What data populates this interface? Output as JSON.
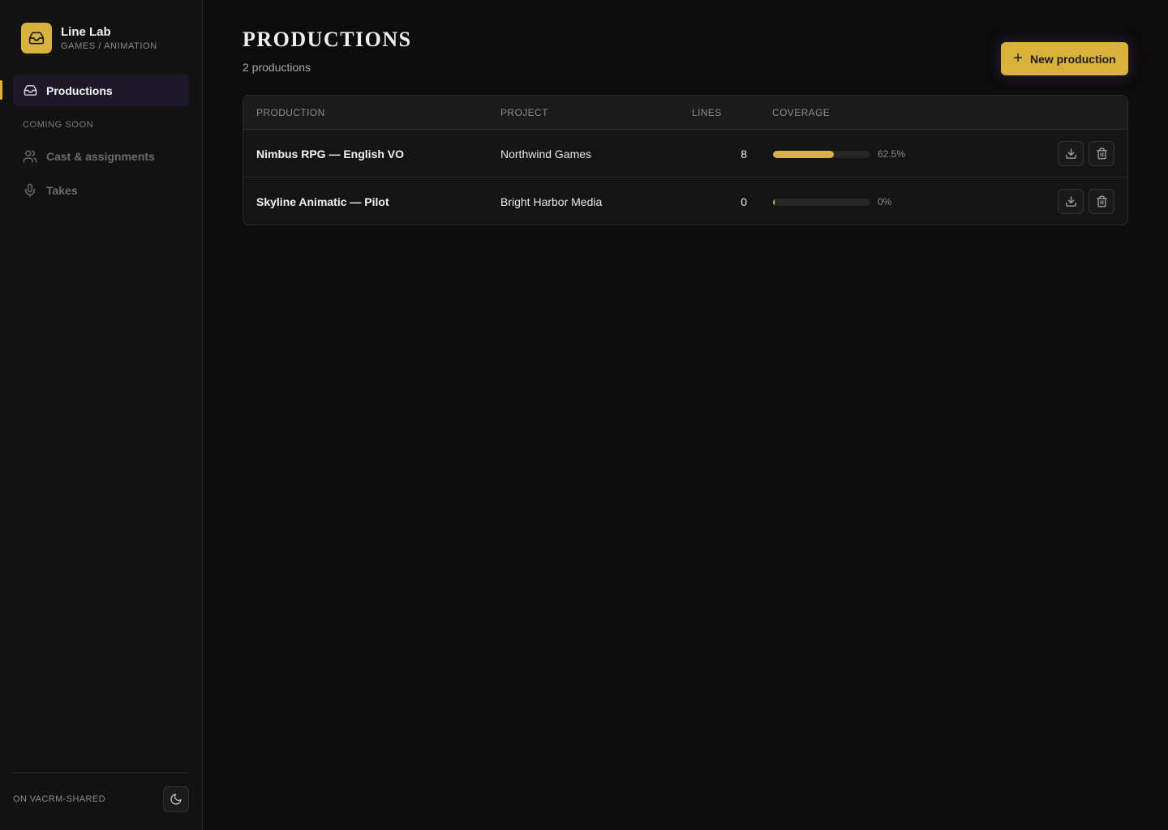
{
  "brand": {
    "name": "Line Lab",
    "subtitle": "GAMES / ANIMATION",
    "icon": "inbox-icon"
  },
  "sidebar": {
    "items": [
      {
        "label": "Productions",
        "icon": "inbox-icon",
        "active": true
      }
    ],
    "section_label": "COMING SOON",
    "soon_items": [
      {
        "label": "Cast & assignments",
        "icon": "users-icon"
      },
      {
        "label": "Takes",
        "icon": "microphone-icon"
      }
    ],
    "footer_label": "ON VACRM-SHARED",
    "theme_icon": "moon-icon"
  },
  "header": {
    "title": "PRODUCTIONS",
    "subtitle": "2 productions",
    "new_button": "New production"
  },
  "table": {
    "columns": [
      "PRODUCTION",
      "PROJECT",
      "LINES",
      "COVERAGE"
    ],
    "rows": [
      {
        "production": "Nimbus RPG — English VO",
        "project": "Northwind Games",
        "lines": "8",
        "coverage": 62.5,
        "coverage_label": "62.5%"
      },
      {
        "production": "Skyline Animatic — Pilot",
        "project": "Bright Harbor Media",
        "lines": "0",
        "coverage": 0,
        "coverage_label": "0%"
      }
    ],
    "row_actions": [
      "download-icon",
      "trash-icon"
    ]
  },
  "colors": {
    "accent": "#d8b23a",
    "background": "#0c0c0c",
    "sidebar": "#121212",
    "active_nav": "#1d1828"
  }
}
